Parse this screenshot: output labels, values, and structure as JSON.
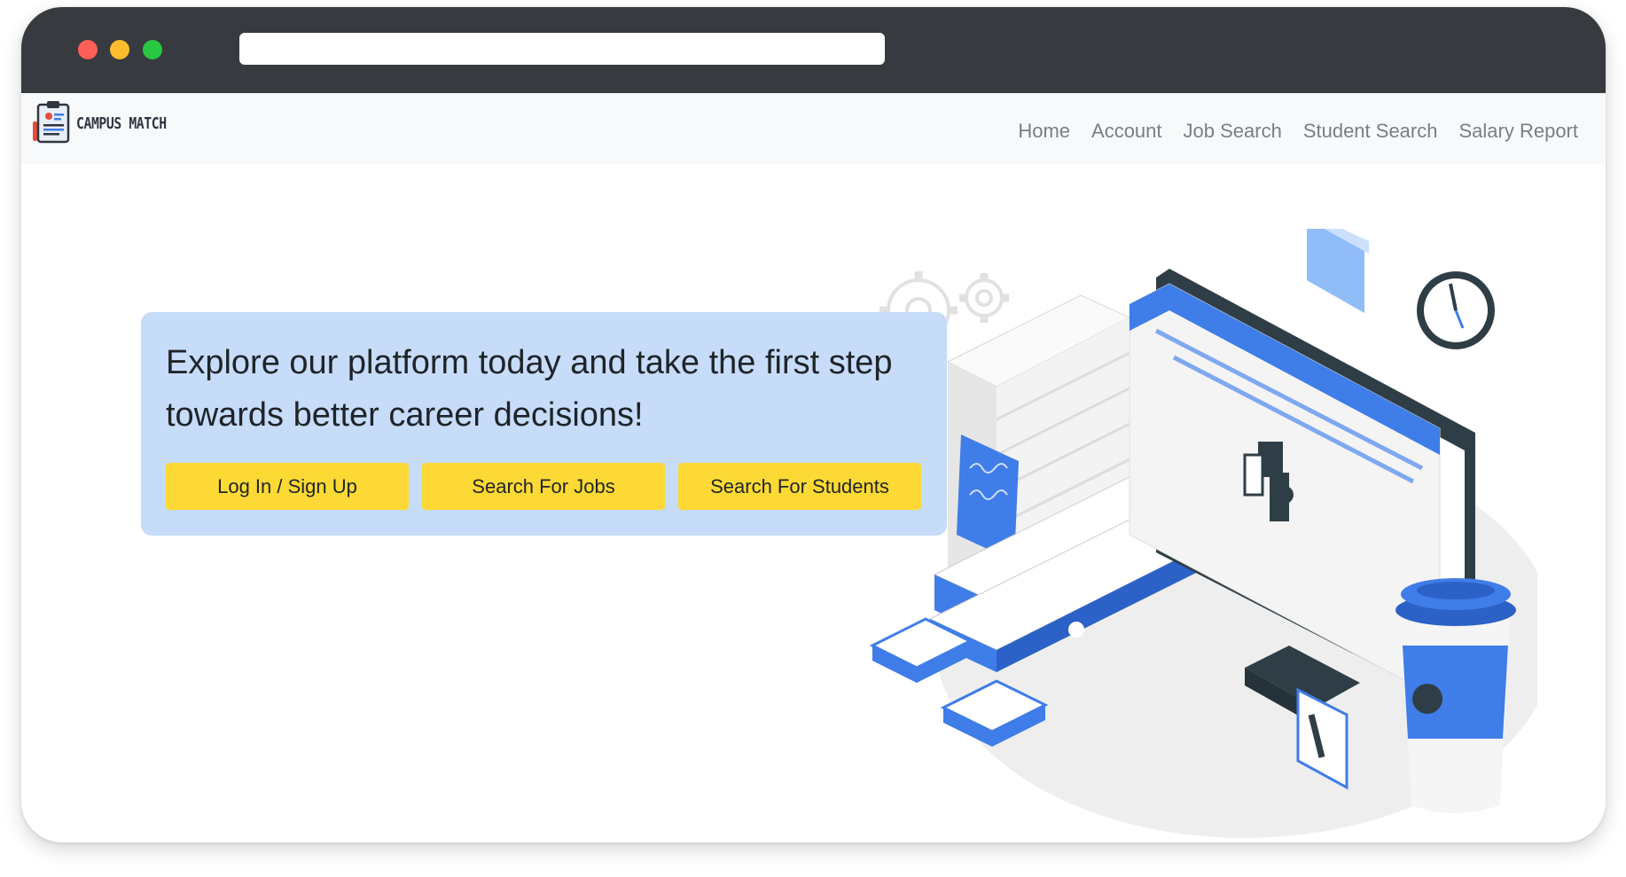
{
  "browser": {
    "url": ""
  },
  "navbar": {
    "brand_name": "CAMPUS MATCH",
    "links": [
      {
        "label": "Home"
      },
      {
        "label": "Account"
      },
      {
        "label": "Job Search"
      },
      {
        "label": "Student Search"
      },
      {
        "label": "Salary Report"
      }
    ]
  },
  "hero": {
    "text": "Explore our platform today and take the first step towards better career decisions!",
    "buttons": [
      {
        "label": "Log In / Sign Up"
      },
      {
        "label": "Search For Jobs"
      },
      {
        "label": "Search For Students"
      }
    ]
  },
  "colors": {
    "chrome": "#373b3f",
    "navbar_bg": "#f8f9fa",
    "hero_bg": "#c6dcf9",
    "button": "#fcd934",
    "accent_blue": "#3f7de8"
  },
  "icons": {
    "logo": "resume-clipboard-icon",
    "illustration": "isometric-office-puzzle-illustration"
  }
}
